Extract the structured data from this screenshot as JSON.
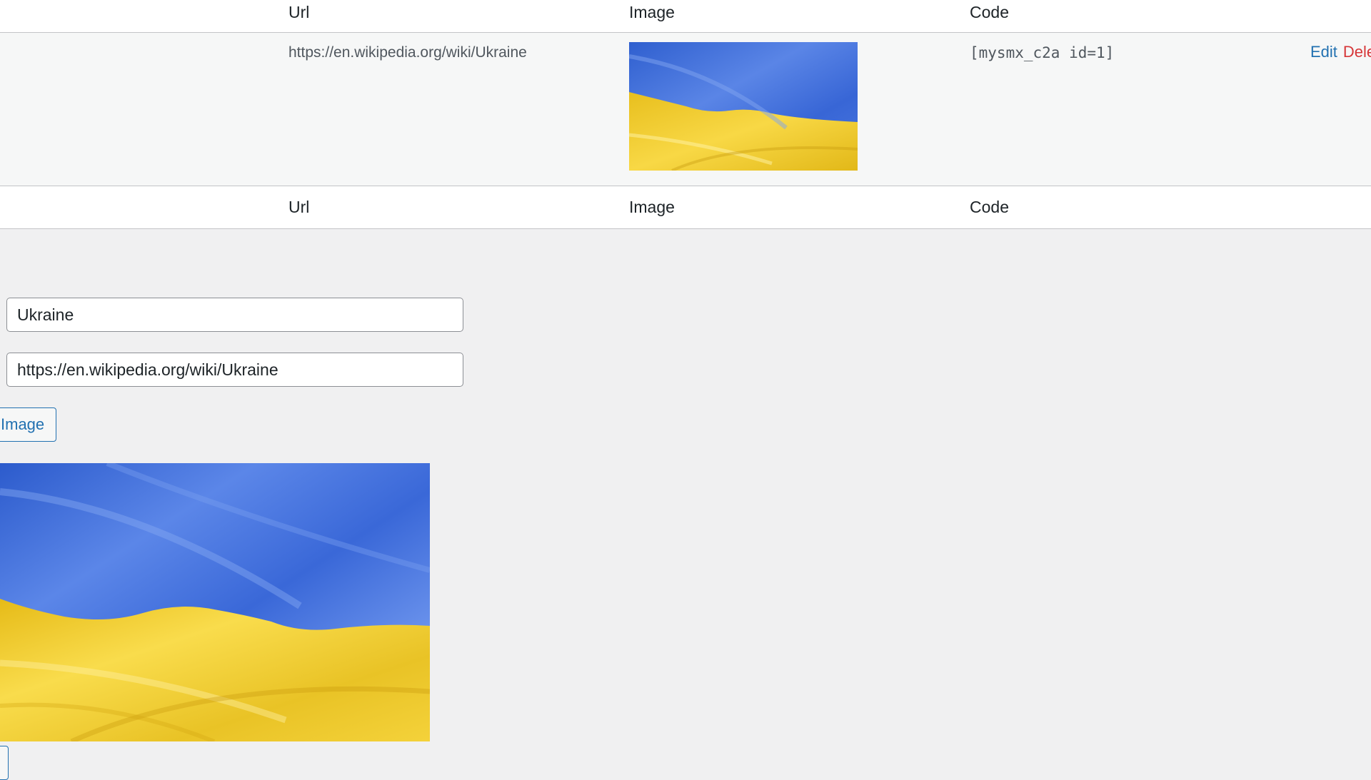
{
  "table": {
    "headers": {
      "url": "Url",
      "image": "Image",
      "code": "Code"
    },
    "rows": [
      {
        "url": "https://en.wikipedia.org/wiki/Ukraine",
        "code": "[mysmx_c2a id=1]",
        "edit_label": "Edit",
        "delete_label": "Dele"
      }
    ],
    "footers": {
      "url": "Url",
      "image": "Image",
      "code": "Code"
    }
  },
  "form": {
    "title_value": "Ukraine",
    "url_value": "https://en.wikipedia.org/wiki/Ukraine",
    "image_button_label": "Image"
  },
  "colors": {
    "flag_blue": "#3f6fd8",
    "flag_yellow": "#f2cd2e",
    "link": "#2271b1",
    "delete": "#d63638",
    "background": "#f0f0f1"
  }
}
